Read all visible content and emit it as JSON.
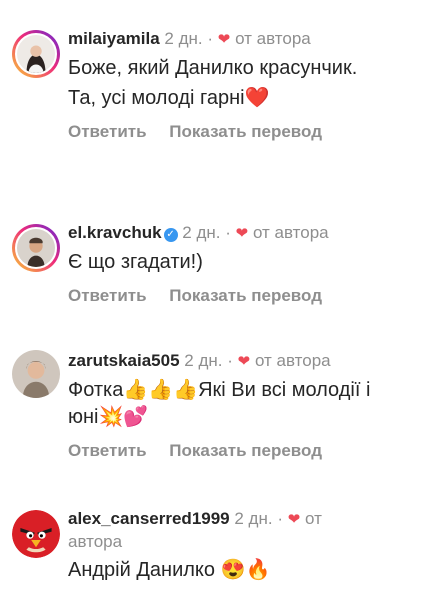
{
  "comments": [
    {
      "username": "milaiyamila",
      "time": "2 дн.",
      "dot": "·",
      "heart": "❤",
      "author_label": "от автора",
      "lines": [
        "Боже, який Данилко красунчик.",
        "Та, усі молоді гарні❤️"
      ],
      "reply": "Ответить",
      "translate": "Показать перевод"
    },
    {
      "username": "el.kravchuk",
      "verified": "✓",
      "time": "2 дн.",
      "dot": "·",
      "heart": "❤",
      "author_label": "от автора",
      "lines": [
        "Є що згадати!)"
      ],
      "reply": "Ответить",
      "translate": "Показать перевод"
    },
    {
      "username": "zarutskaia505",
      "time": "2 дн.",
      "dot": "·",
      "heart": "❤",
      "author_label": "от автора",
      "lines": [
        "Фотка👍👍👍Які Ви всі молодії і юні💥💕"
      ],
      "reply": "Ответить",
      "translate": "Показать перевод"
    },
    {
      "username": "alex_canserred1999",
      "time": "2 дн.",
      "dot": "·",
      "heart": "❤",
      "author_label": "от автора",
      "lines": [
        "Андрій Данилко 😍🔥"
      ]
    }
  ]
}
